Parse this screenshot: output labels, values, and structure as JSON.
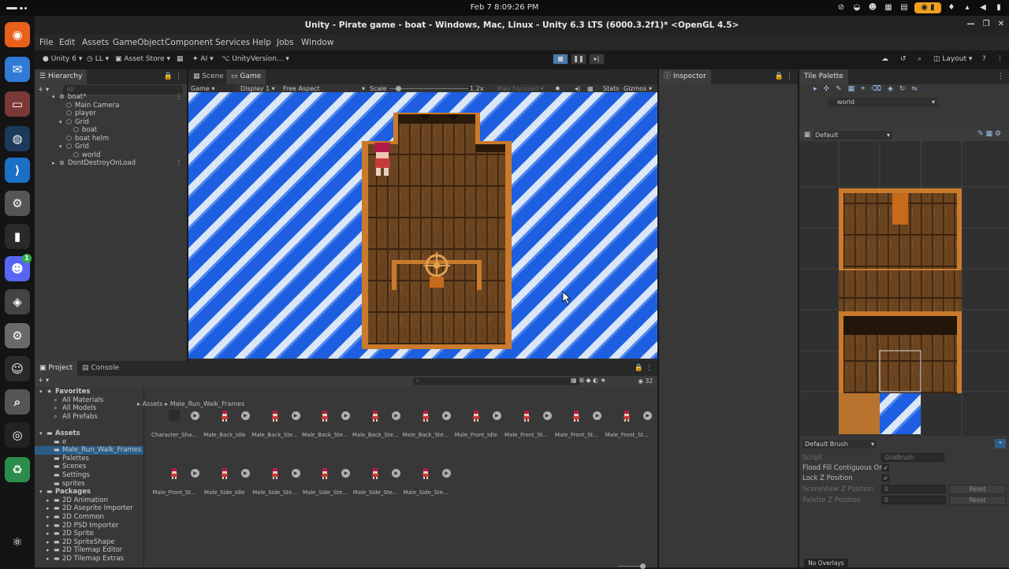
{
  "os_bar": {
    "clock": "Feb 7  8:09:26 PM"
  },
  "dock": {
    "items": [
      {
        "name": "firefox-icon",
        "glyph": "◉",
        "color": "#e8601c"
      },
      {
        "name": "thunderbird-icon",
        "glyph": "✉",
        "color": "#2f7bd6"
      },
      {
        "name": "files-icon",
        "glyph": "▭",
        "color": "#7a3a3a"
      },
      {
        "name": "steam-icon",
        "glyph": "◍",
        "color": "#1b3a5c"
      },
      {
        "name": "vscode-icon",
        "glyph": "⟩",
        "color": "#1b6fc4"
      },
      {
        "name": "settings-gear-icon",
        "glyph": "⚙",
        "color": "#555555"
      },
      {
        "name": "terminal-icon",
        "glyph": "▮",
        "color": "#2a2a2a"
      },
      {
        "name": "discord-icon",
        "glyph": "☻",
        "color": "#5865f2",
        "badge": "1"
      },
      {
        "name": "unity-hub-icon",
        "glyph": "◈",
        "color": "#444444"
      },
      {
        "name": "settings-icon",
        "glyph": "⚙",
        "color": "#6a6a6a"
      },
      {
        "name": "pixel-face-icon",
        "glyph": "☺",
        "color": "#2a2a2a"
      },
      {
        "name": "search-icon",
        "glyph": "⌕",
        "color": "#555555"
      },
      {
        "name": "obs-icon",
        "glyph": "◎",
        "color": "#222222"
      },
      {
        "name": "trash-icon",
        "glyph": "♻",
        "color": "#2c8c4c"
      },
      {
        "name": "show-apps-icon",
        "glyph": "⚛",
        "color": "#141414"
      }
    ]
  },
  "window": {
    "title": "Unity - Pirate game - boat - Windows, Mac, Linux - Unity 6.3 LTS (6000.3.2f1)* <OpenGL 4.5>"
  },
  "menu": [
    "File",
    "Edit",
    "Assets",
    "GameObject",
    "Component",
    "Services",
    "Help",
    "Jobs",
    "Window"
  ],
  "toolbar": {
    "account": "Unity 6",
    "ll": "LL",
    "asset_store": "Asset Store",
    "ai": "AI",
    "version_control": "UnityVersion...",
    "layout": "Layout"
  },
  "hierarchy": {
    "tab": "Hierarchy",
    "search_placeholder": "All",
    "rows": [
      {
        "label": "boat*",
        "depth": 0,
        "fold": "▾",
        "icon": "scene"
      },
      {
        "label": "Main Camera",
        "depth": 1,
        "fold": "",
        "icon": "obj"
      },
      {
        "label": "player",
        "depth": 1,
        "fold": "",
        "icon": "obj"
      },
      {
        "label": "Grid",
        "depth": 1,
        "fold": "▾",
        "icon": "obj"
      },
      {
        "label": "boat",
        "depth": 2,
        "fold": "",
        "icon": "obj"
      },
      {
        "label": "boat helm",
        "depth": 1,
        "fold": "",
        "icon": "obj"
      },
      {
        "label": "Grid",
        "depth": 1,
        "fold": "▾",
        "icon": "obj"
      },
      {
        "label": "world",
        "depth": 2,
        "fold": "",
        "icon": "obj"
      },
      {
        "label": "DontDestroyOnLoad",
        "depth": 0,
        "fold": "▸",
        "icon": "scene"
      }
    ]
  },
  "scene_tabs": {
    "scene": "Scene",
    "game": "Game",
    "game_mode": "Game",
    "display": "Display 1",
    "aspect": "Free Aspect",
    "scale_label": "Scale",
    "scale_value": "1.2x",
    "play_focused": "Play Focused",
    "stats": "Stats",
    "gizmos": "Gizmos"
  },
  "inspector": {
    "tab": "Inspector"
  },
  "tile_palette": {
    "tab": "Tile Palette",
    "palette": "world",
    "brush_layer": "Default",
    "brush": "Default Brush",
    "script_label": "Script",
    "script_value": "GridBrush",
    "flood_fill": "Flood Fill Contiguous Only",
    "lock_z": "Lock Z Position",
    "sceneview_z": "SceneView Z Position",
    "palette_z": "Palette Z Position",
    "zero": "0",
    "reset": "Reset",
    "overlays": "No Overlays"
  },
  "project": {
    "tab_project": "Project",
    "tab_console": "Console",
    "breadcrumb_root": "Assets",
    "breadcrumb_folder": "Male_Run_Walk_Frames",
    "count": "32",
    "tree": [
      {
        "label": "Favorites",
        "depth": 0,
        "fold": "▾",
        "kind": "star"
      },
      {
        "label": "All Materials",
        "depth": 1,
        "fold": "",
        "kind": "search"
      },
      {
        "label": "All Models",
        "depth": 1,
        "fold": "",
        "kind": "search"
      },
      {
        "label": "All Prefabs",
        "depth": 1,
        "fold": "",
        "kind": "search"
      },
      {
        "label": "",
        "depth": 0,
        "fold": "",
        "kind": "gap"
      },
      {
        "label": "Assets",
        "depth": 0,
        "fold": "▾",
        "kind": "folder"
      },
      {
        "label": "e",
        "depth": 1,
        "fold": "",
        "kind": "folder"
      },
      {
        "label": "Male_Run_Walk_Frames",
        "depth": 1,
        "fold": "",
        "kind": "folder",
        "selected": true
      },
      {
        "label": "Palettes",
        "depth": 1,
        "fold": "",
        "kind": "folder"
      },
      {
        "label": "Scenes",
        "depth": 1,
        "fold": "",
        "kind": "folder"
      },
      {
        "label": "Settings",
        "depth": 1,
        "fold": "",
        "kind": "folder"
      },
      {
        "label": "sprites",
        "depth": 1,
        "fold": "",
        "kind": "folder"
      },
      {
        "label": "Packages",
        "depth": 0,
        "fold": "▾",
        "kind": "folder"
      },
      {
        "label": "2D Animation",
        "depth": 1,
        "fold": "▸",
        "kind": "folder"
      },
      {
        "label": "2D Aseprite Importer",
        "depth": 1,
        "fold": "▸",
        "kind": "folder"
      },
      {
        "label": "2D Common",
        "depth": 1,
        "fold": "▸",
        "kind": "folder"
      },
      {
        "label": "2D PSD Importer",
        "depth": 1,
        "fold": "▸",
        "kind": "folder"
      },
      {
        "label": "2D Sprite",
        "depth": 1,
        "fold": "▸",
        "kind": "folder"
      },
      {
        "label": "2D SpriteShape",
        "depth": 1,
        "fold": "▸",
        "kind": "folder"
      },
      {
        "label": "2D Tilemap Editor",
        "depth": 1,
        "fold": "▸",
        "kind": "folder"
      },
      {
        "label": "2D Tilemap Extras",
        "depth": 1,
        "fold": "▸",
        "kind": "folder"
      }
    ],
    "assets_row1": [
      "Character_Sha...",
      "Male_Back_Idle",
      "Male_Back_Ste...",
      "Male_Back_Ste...",
      "Male_Back_Ste...",
      "Male_Back_Ste...",
      "Male_Front_Idle",
      "Male_Front_St...",
      "Male_Front_St...",
      "Male_Front_St..."
    ],
    "assets_row2": [
      "Male_Front_St...",
      "Male_Side_Idle",
      "Male_Side_Ste...",
      "Male_Side_Ste...",
      "Male_Side_Ste...",
      "Male_Side_Ste..."
    ]
  }
}
